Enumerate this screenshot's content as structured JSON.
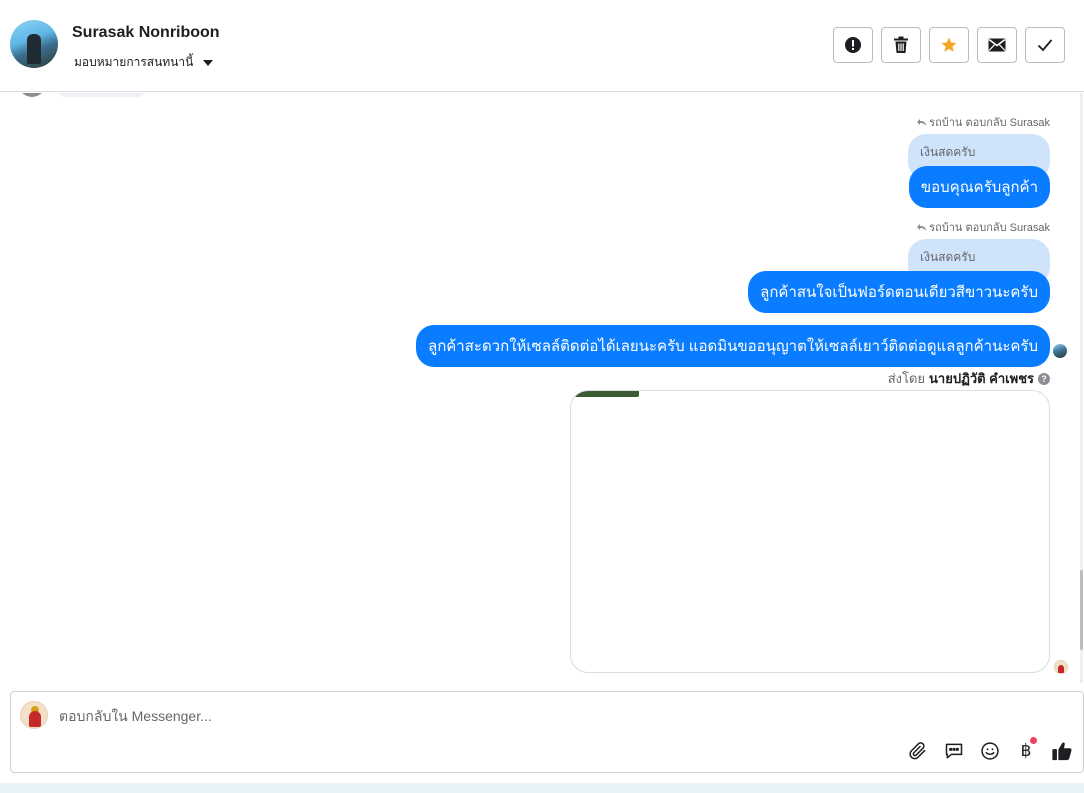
{
  "header": {
    "contact_name": "Surasak Nonriboon",
    "assign_label": "มอบหมายการสนทนานี้",
    "actions": [
      {
        "icon": "exclamation-icon",
        "name": "mark-spam-button"
      },
      {
        "icon": "trash-icon",
        "name": "delete-button"
      },
      {
        "icon": "star-icon",
        "name": "star-button",
        "color": "#f5a623"
      },
      {
        "icon": "envelope-icon",
        "name": "mark-unread-button"
      },
      {
        "icon": "check-icon",
        "name": "mark-done-button"
      }
    ]
  },
  "messages": [
    {
      "reply_meta": "รถบ้าน ตอบกลับ Surasak",
      "quote": "เงินสดครับ",
      "text": "ขอบคุณครับลูกค้า"
    },
    {
      "reply_meta": "รถบ้าน ตอบกลับ Surasak",
      "quote": "เงินสดครับ",
      "text": "ลูกค้าสนใจเป็นฟอร์ดตอนเดียวสีขาวนะครับ"
    },
    {
      "text": "ลูกค้าสะดวกให้เซลล์ติดต่อได้เลยนะครับ แอดมินขออนุญาตให้เซลล์เยาว์ติดต่อดูแลลูกค้านะครับ"
    }
  ],
  "sent_by": {
    "prefix": "ส่งโดย",
    "name": "นายปฏิวัติ คำเพชร",
    "help_glyph": "?"
  },
  "composer": {
    "placeholder": "ตอบกลับใน Messenger...",
    "tools": [
      "paperclip-icon",
      "saved-replies-icon",
      "emoji-icon",
      "baht-payment-icon",
      "like-icon"
    ],
    "baht_glyph": "฿"
  },
  "colors": {
    "bubble": "#0a7cff",
    "quote": "#cfe3fb",
    "border": "#dadde1",
    "accent_star": "#f5a623",
    "notification_dot": "#f3425f"
  }
}
